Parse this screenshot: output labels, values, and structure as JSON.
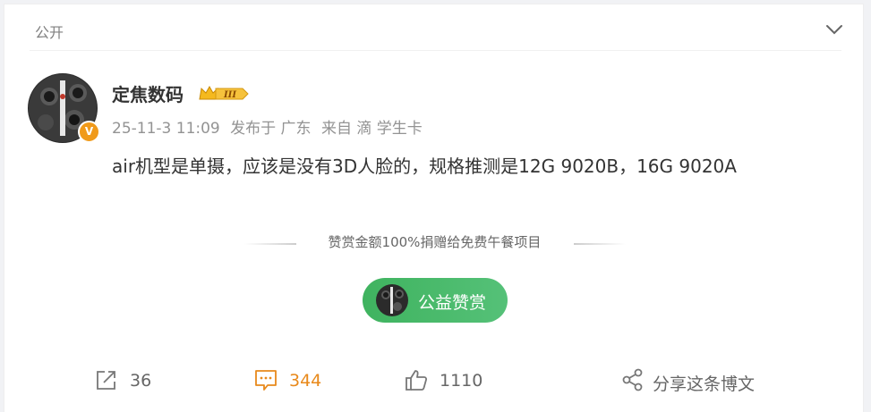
{
  "header": {
    "visibility_label": "公开"
  },
  "post": {
    "author": "定焦数码",
    "badge_text": "III",
    "verified_mark": "V",
    "date": "25-11-3 11:09",
    "location": "发布于 广东",
    "source": "来自 滴 学生卡",
    "text": "air机型是单摄，应该是没有3D人脸的，规格推测是12G 9020B，16G 9020A"
  },
  "reward": {
    "notice": "赞赏金额100%捐赠给免费午餐项目",
    "button_label": "公益赞赏"
  },
  "toolbar": {
    "forward_count": "36",
    "comment_count": "344",
    "like_count": "1110",
    "share_label": "分享这条博文"
  },
  "colors": {
    "accent": "#e8891b",
    "reward_green": "#4bb86a",
    "verified": "#f09a1a"
  }
}
